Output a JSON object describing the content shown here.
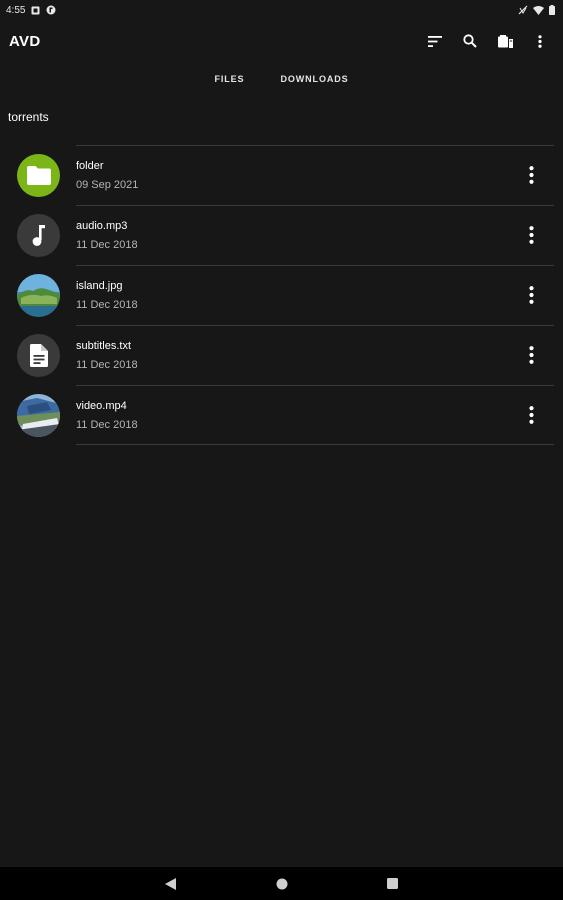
{
  "status_bar": {
    "time": "4:55",
    "icons": [
      "sd-card-icon",
      "app-notification-icon",
      "wifi-off-icon",
      "wifi-icon",
      "battery-icon"
    ]
  },
  "app_bar": {
    "title": "AVD",
    "actions": [
      "sort-icon",
      "search-icon",
      "storage-icon",
      "more-vert-icon"
    ]
  },
  "tabs": [
    {
      "label": "FILES"
    },
    {
      "label": "DOWNLOADS"
    }
  ],
  "breadcrumb": "torrents",
  "files": [
    {
      "name": "folder",
      "date": "09 Sep 2021",
      "icon": "folder-icon",
      "thumb_color": "#7cb518"
    },
    {
      "name": "audio.mp3",
      "date": "11 Dec 2018",
      "icon": "music-note-icon",
      "thumb_color": "#3a3a3a"
    },
    {
      "name": "island.jpg",
      "date": "11 Dec 2018",
      "icon": "image-thumbnail",
      "thumb_color": "#4a8fb8"
    },
    {
      "name": "subtitles.txt",
      "date": "11 Dec 2018",
      "icon": "document-icon",
      "thumb_color": "#3a3a3a"
    },
    {
      "name": "video.mp4",
      "date": "11 Dec 2018",
      "icon": "video-thumbnail",
      "thumb_color": "#5a7fa8"
    }
  ],
  "nav_bar": {
    "buttons": [
      "back-icon",
      "home-icon",
      "recents-icon"
    ]
  },
  "colors": {
    "background": "#171717",
    "divider": "#3a3a3a",
    "accent_folder": "#7cb518",
    "navbar": "#000000"
  }
}
